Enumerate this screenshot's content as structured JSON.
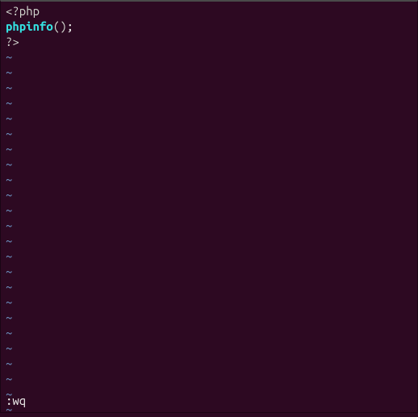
{
  "code": {
    "line1_open": "<?php",
    "line2_func": "phpinfo",
    "line2_parens": "()",
    "line2_semi": ";",
    "line3_close": "?>"
  },
  "tilde": "~",
  "tilde_count": 24,
  "command": ":wq"
}
